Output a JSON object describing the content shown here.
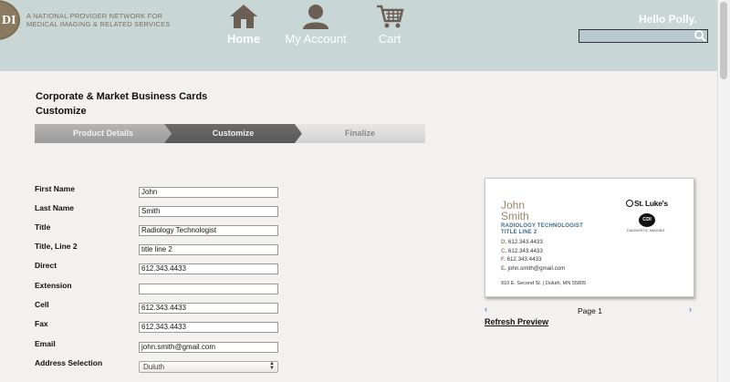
{
  "header": {
    "logo_letters": "DI",
    "tagline": "A NATIONAL PROVIDER NETWORK FOR MEDICAL IMAGING & RELATED SERVICES",
    "nav": [
      {
        "label": "Home",
        "icon": "home-icon"
      },
      {
        "label": "My Account",
        "icon": "account-icon"
      },
      {
        "label": "Cart",
        "icon": "cart-icon"
      }
    ],
    "greeting": "Hello Polly.",
    "search": {
      "value": "",
      "icon": "search-icon"
    }
  },
  "page": {
    "title_line1": "Corporate & Market Business Cards",
    "title_line2": "Customize"
  },
  "steps": [
    {
      "label": "Product Details",
      "state": "done"
    },
    {
      "label": "Customize",
      "state": "active"
    },
    {
      "label": "Finalize",
      "state": "todo"
    }
  ],
  "form": {
    "fields": [
      {
        "label": "First Name",
        "value": "John"
      },
      {
        "label": "Last Name",
        "value": "Smith"
      },
      {
        "label": "Title",
        "value": "Radiology Technologist"
      },
      {
        "label": "Title, Line 2",
        "value": "title line 2"
      },
      {
        "label": "Direct",
        "value": "612.343.4433"
      },
      {
        "label": "Extension",
        "value": ""
      },
      {
        "label": "Cell",
        "value": "612.343.4433"
      },
      {
        "label": "Fax",
        "value": "612.343.4433"
      },
      {
        "label": "Email",
        "value": "john.smith@gmail.com"
      },
      {
        "label": "Address Selection",
        "value": "Duluth"
      }
    ]
  },
  "preview": {
    "first_name": "John",
    "last_name": "Smith",
    "title": "RADIOLOGY TECHNOLOGIST",
    "title2": "TITLE LINE 2",
    "contacts": [
      {
        "prefix": "D.",
        "value": "612.343.4433"
      },
      {
        "prefix": "C.",
        "value": "612.343.4433"
      },
      {
        "prefix": "F.",
        "value": "612.343.4433"
      },
      {
        "prefix": "E.",
        "value": "john.smith@gmail.com"
      }
    ],
    "address": "910 E. Second St. | Duluth, MN 55805",
    "logo_stlukes": "St. Luke's",
    "logo_cdi": "CDI",
    "logo_cdi_text": "DIAGNOSTIC IMAGING",
    "page_label": "Page 1",
    "prev_arrow": "‹",
    "next_arrow": "›",
    "refresh_label": "Refresh Preview"
  }
}
